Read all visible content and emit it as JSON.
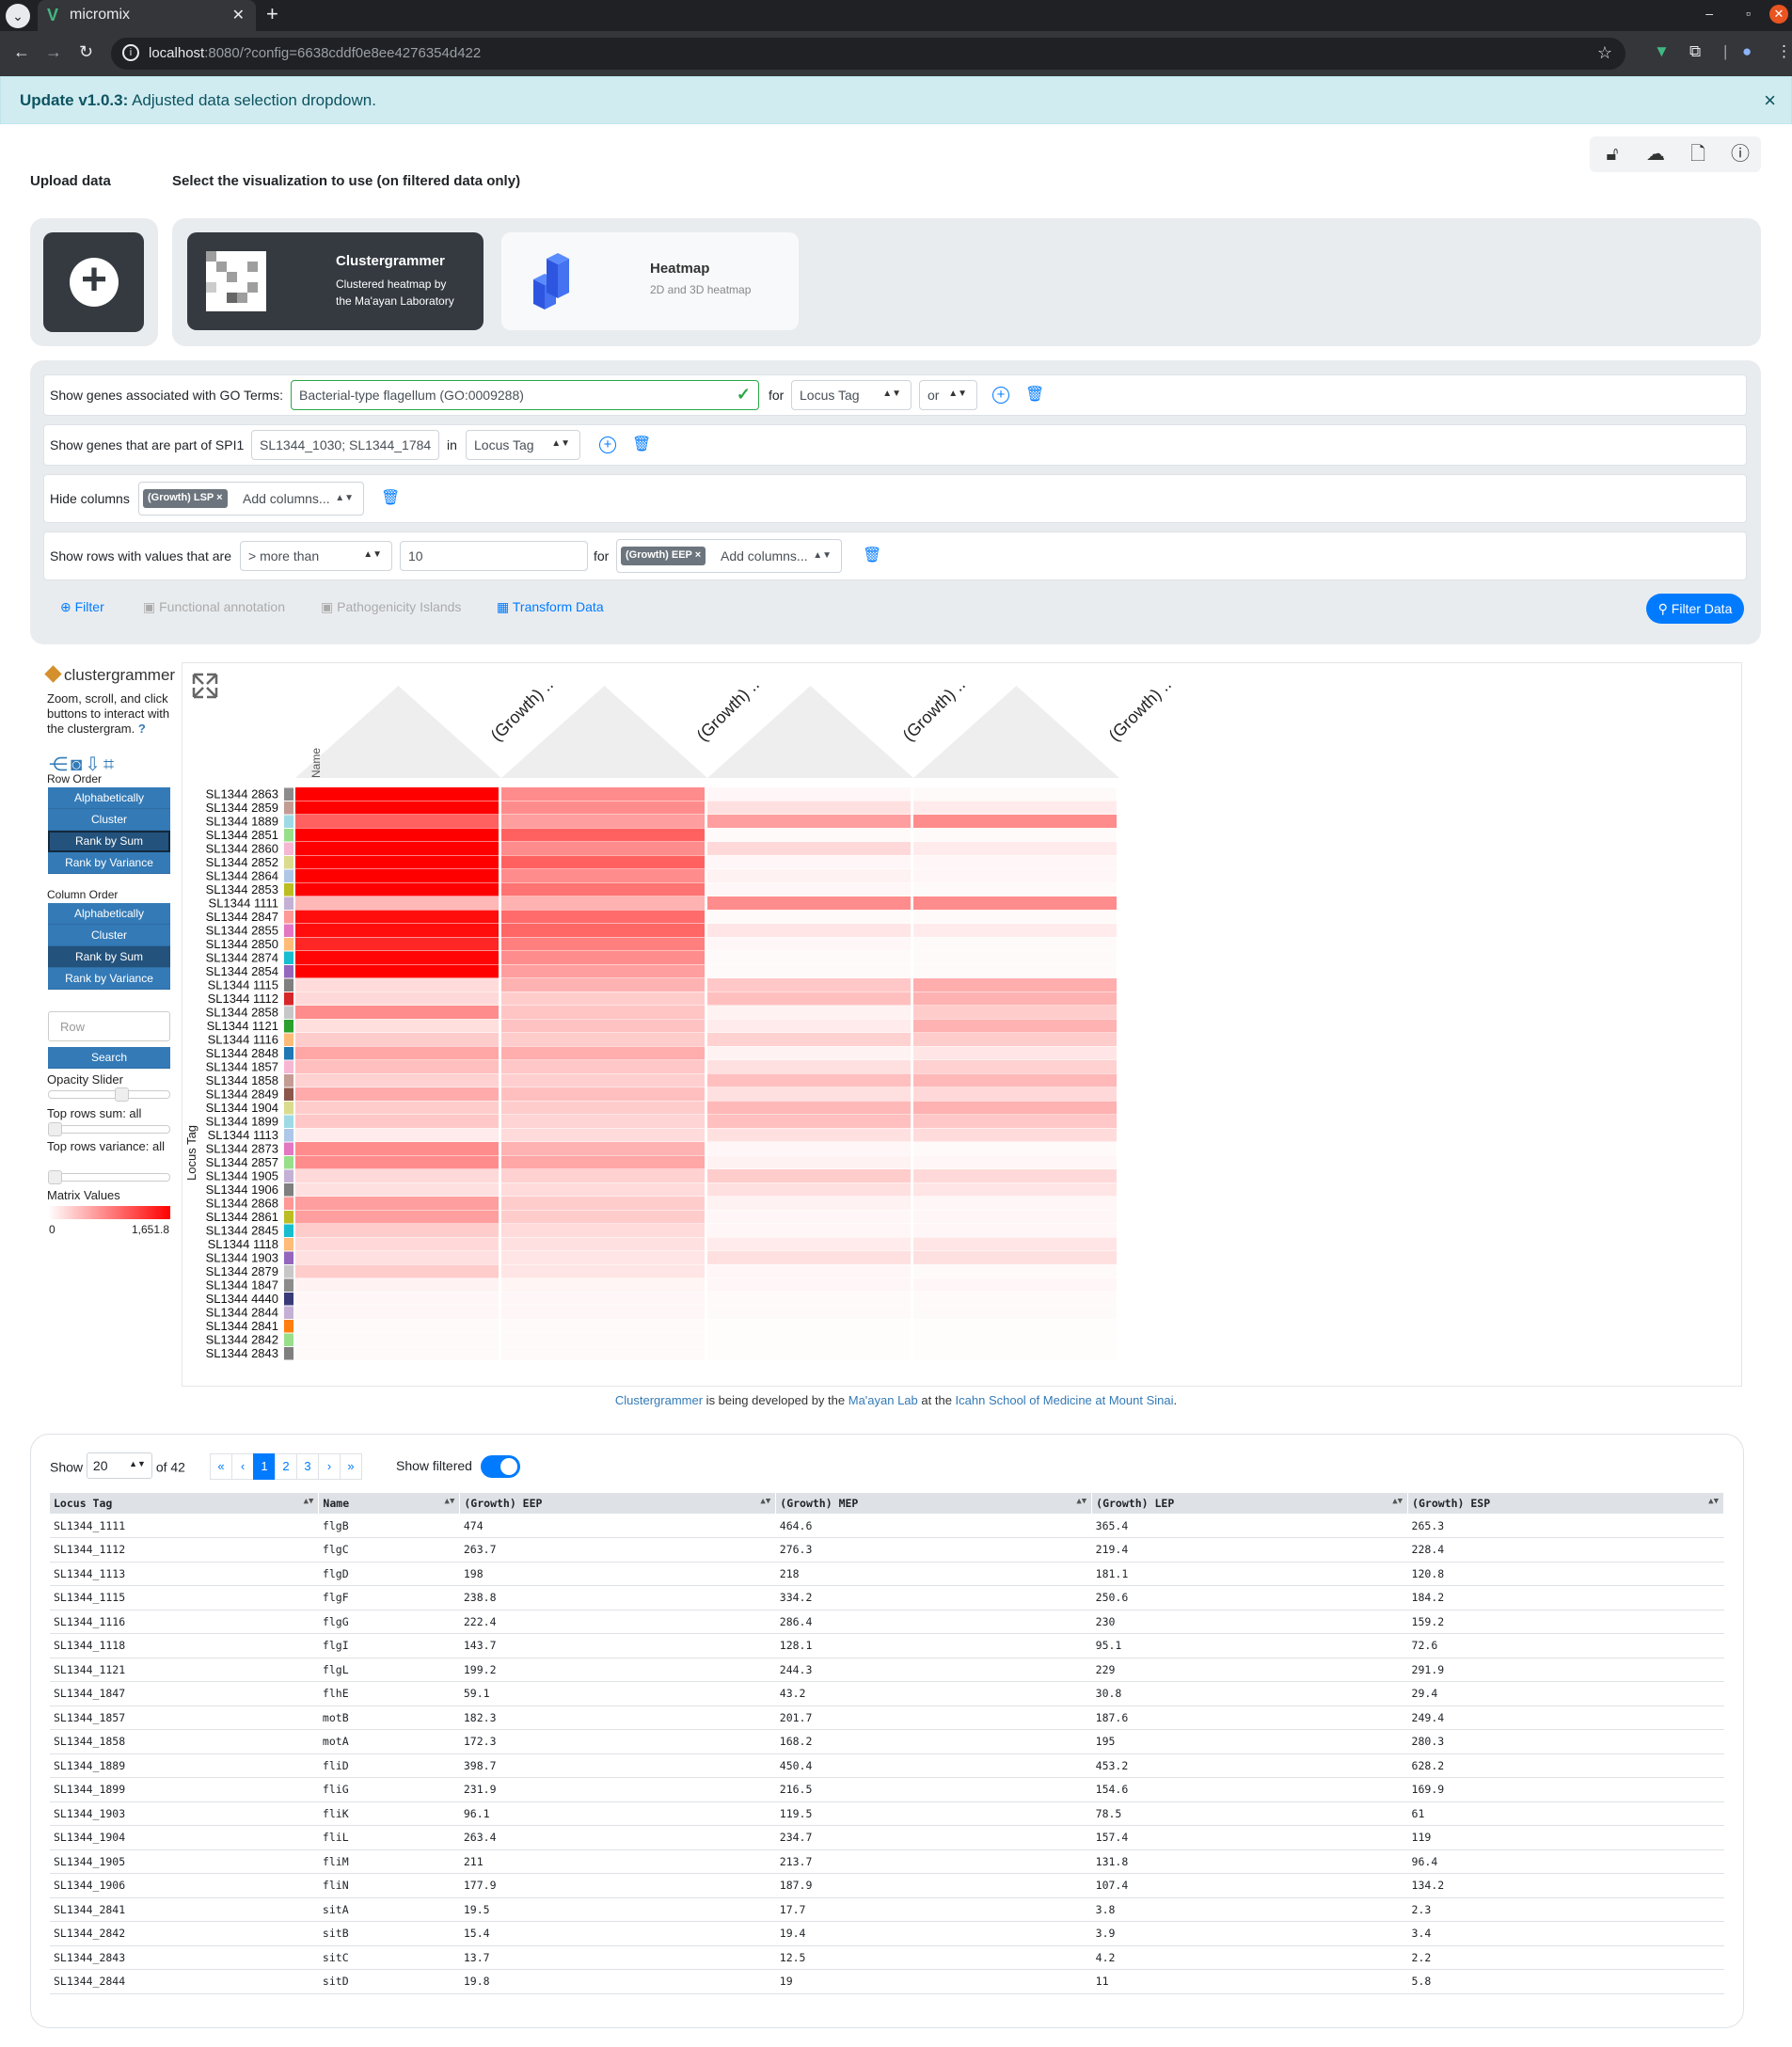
{
  "browser": {
    "tab_title": "micromix",
    "url_host": "localhost",
    "url_rest": ":8080/?config=6638cddf0e8ee4276354d422"
  },
  "alert": {
    "title": "Update v1.0.3:",
    "message": "Adjusted data selection dropdown."
  },
  "header": {
    "upload_label": "Upload data",
    "select_label": "Select the visualization to use (on filtered data only)"
  },
  "viz": {
    "clustergrammer": {
      "title": "Clustergrammer",
      "sub1": "Clustered heatmap by",
      "sub2": "the Ma'ayan Laboratory"
    },
    "heatmap": {
      "title": "Heatmap",
      "sub": "2D and 3D heatmap"
    }
  },
  "filters": {
    "go": {
      "label": "Show genes associated with GO Terms:",
      "value": "Bacterial-type flagellum (GO:0009288)",
      "for": "for",
      "field": "Locus Tag",
      "logic": "or"
    },
    "spi": {
      "label": "Show genes that are part of SPI1",
      "value": "SL1344_1030; SL1344_1784",
      "in": "in",
      "field": "Locus Tag"
    },
    "hide": {
      "label": "Hide columns",
      "tag": "(Growth) LSP",
      "placeholder": "Add columns..."
    },
    "rows": {
      "label": "Show rows with values that are",
      "op": "> more than",
      "value": "10",
      "for": "for",
      "tag": "(Growth) EEP",
      "placeholder": "Add columns..."
    },
    "tabs": {
      "filter": "Filter",
      "functional": "Functional annotation",
      "pathogenicity": "Pathogenicity Islands",
      "transform": "Transform Data"
    },
    "submit": "Filter Data"
  },
  "cg": {
    "logo": "clustergrammer",
    "desc": "Zoom, scroll, and click buttons to interact with the clustergram.",
    "help": "?",
    "row_order_label": "Row Order",
    "col_order_label": "Column Order",
    "order_buttons": [
      "Alphabetically",
      "Cluster",
      "Rank by Sum",
      "Rank by Variance"
    ],
    "row_placeholder": "Row",
    "search": "Search",
    "opacity": "Opacity Slider",
    "top_sum": "Top rows sum: all",
    "top_var": "Top rows variance: all",
    "matrix_values": "Matrix Values",
    "min": "0",
    "max": "1,651.8",
    "row_axis_label": "Locus Tag",
    "col_axis_label": "Name",
    "columns": [
      "(Growth) ..",
      "(Growth) ..",
      "(Growth) ..",
      "(Growth) .."
    ],
    "rows": [
      "SL1344 2863",
      "SL1344 2859",
      "SL1344 1889",
      "SL1344 2851",
      "SL1344 2860",
      "SL1344 2852",
      "SL1344 2864",
      "SL1344 2853",
      "SL1344 1111",
      "SL1344 2847",
      "SL1344 2855",
      "SL1344 2850",
      "SL1344 2874",
      "SL1344 2854",
      "SL1344 1115",
      "SL1344 1112",
      "SL1344 2858",
      "SL1344 1121",
      "SL1344 1116",
      "SL1344 2848",
      "SL1344 1857",
      "SL1344 1858",
      "SL1344 2849",
      "SL1344 1904",
      "SL1344 1899",
      "SL1344 1113",
      "SL1344 2873",
      "SL1344 2857",
      "SL1344 1905",
      "SL1344 1906",
      "SL1344 2868",
      "SL1344 2861",
      "SL1344 2845",
      "SL1344 1118",
      "SL1344 1903",
      "SL1344 2879",
      "SL1344 1847",
      "SL1344 4440",
      "SL1344 2844",
      "SL1344 2841",
      "SL1344 2842",
      "SL1344 2843"
    ],
    "row_colors": [
      "#8c8c8c",
      "#c49c94",
      "#9edae5",
      "#98df8a",
      "#f7b6d2",
      "#dbdb8d",
      "#aec7e8",
      "#bcbd22",
      "#c5b0d5",
      "#ff9896",
      "#e377c2",
      "#ffbb78",
      "#17becf",
      "#9467bd",
      "#7f7f7f",
      "#d62728",
      "#c7c7c7",
      "#2ca02c",
      "#ffbb78",
      "#1f77b4",
      "#f7b6d2",
      "#c49c94",
      "#8c564b",
      "#dbdb8d",
      "#9edae5",
      "#aec7e8",
      "#e377c2",
      "#98df8a",
      "#c5b0d5",
      "#7f7f7f",
      "#ff9896",
      "#bcbd22",
      "#17becf",
      "#ffbb78",
      "#9467bd",
      "#c7c7c7",
      "#8c8c8c",
      "#393b79",
      "#c5b0d5",
      "#ff7f0e",
      "#98df8a",
      "#7f7f7f"
    ],
    "matrix": [
      [
        1.0,
        0.45,
        0.03,
        0.02
      ],
      [
        1.0,
        0.45,
        0.12,
        0.08
      ],
      [
        0.62,
        0.38,
        0.38,
        0.45
      ],
      [
        1.0,
        0.62,
        0.02,
        0.02
      ],
      [
        1.0,
        0.45,
        0.15,
        0.08
      ],
      [
        1.0,
        0.62,
        0.03,
        0.03
      ],
      [
        1.0,
        0.45,
        0.05,
        0.03
      ],
      [
        1.0,
        0.55,
        0.03,
        0.02
      ],
      [
        0.28,
        0.3,
        0.45,
        0.45
      ],
      [
        0.95,
        0.58,
        0.02,
        0.02
      ],
      [
        0.95,
        0.6,
        0.1,
        0.08
      ],
      [
        0.85,
        0.5,
        0.03,
        0.02
      ],
      [
        0.98,
        0.45,
        0.02,
        0.02
      ],
      [
        1.0,
        0.38,
        0.02,
        0.02
      ],
      [
        0.14,
        0.3,
        0.22,
        0.32
      ],
      [
        0.15,
        0.2,
        0.25,
        0.3
      ],
      [
        0.45,
        0.23,
        0.05,
        0.2
      ],
      [
        0.13,
        0.24,
        0.08,
        0.3
      ],
      [
        0.2,
        0.2,
        0.18,
        0.2
      ],
      [
        0.35,
        0.32,
        0.05,
        0.1
      ],
      [
        0.25,
        0.22,
        0.12,
        0.18
      ],
      [
        0.18,
        0.19,
        0.25,
        0.28
      ],
      [
        0.33,
        0.25,
        0.12,
        0.15
      ],
      [
        0.2,
        0.2,
        0.28,
        0.3
      ],
      [
        0.22,
        0.17,
        0.25,
        0.22
      ],
      [
        0.08,
        0.14,
        0.12,
        0.14
      ],
      [
        0.45,
        0.3,
        0.03,
        0.02
      ],
      [
        0.45,
        0.35,
        0.05,
        0.03
      ],
      [
        0.15,
        0.18,
        0.2,
        0.15
      ],
      [
        0.12,
        0.14,
        0.12,
        0.1
      ],
      [
        0.38,
        0.2,
        0.05,
        0.03
      ],
      [
        0.38,
        0.2,
        0.03,
        0.03
      ],
      [
        0.2,
        0.14,
        0.03,
        0.03
      ],
      [
        0.15,
        0.12,
        0.08,
        0.1
      ],
      [
        0.12,
        0.1,
        0.12,
        0.12
      ],
      [
        0.2,
        0.1,
        0.03,
        0.02
      ],
      [
        0.05,
        0.04,
        0.03,
        0.03
      ],
      [
        0.03,
        0.03,
        0.02,
        0.02
      ],
      [
        0.03,
        0.03,
        0.02,
        0.02
      ],
      [
        0.02,
        0.02,
        0.01,
        0.01
      ],
      [
        0.02,
        0.02,
        0.01,
        0.01
      ],
      [
        0.02,
        0.02,
        0.01,
        0.01
      ]
    ]
  },
  "credit": {
    "cg": "Clustergrammer",
    "t1": " is being developed by the ",
    "lab": "Ma'ayan Lab",
    "t2": " at the ",
    "school": "Icahn School of Medicine at Mount Sinai",
    "t3": "."
  },
  "table": {
    "show": "Show",
    "per_page": "20",
    "of": "of 42",
    "pages": [
      "«",
      "‹",
      "1",
      "2",
      "3",
      "›",
      "»"
    ],
    "show_filtered": "Show filtered",
    "headers": [
      "Locus Tag",
      "Name",
      "(Growth) EEP",
      "(Growth) MEP",
      "(Growth) LEP",
      "(Growth) ESP"
    ],
    "rows": [
      [
        "SL1344_1111",
        "flgB",
        "474",
        "464.6",
        "365.4",
        "265.3"
      ],
      [
        "SL1344_1112",
        "flgC",
        "263.7",
        "276.3",
        "219.4",
        "228.4"
      ],
      [
        "SL1344_1113",
        "flgD",
        "198",
        "218",
        "181.1",
        "120.8"
      ],
      [
        "SL1344_1115",
        "flgF",
        "238.8",
        "334.2",
        "250.6",
        "184.2"
      ],
      [
        "SL1344_1116",
        "flgG",
        "222.4",
        "286.4",
        "230",
        "159.2"
      ],
      [
        "SL1344_1118",
        "flgI",
        "143.7",
        "128.1",
        "95.1",
        "72.6"
      ],
      [
        "SL1344_1121",
        "flgL",
        "199.2",
        "244.3",
        "229",
        "291.9"
      ],
      [
        "SL1344_1847",
        "flhE",
        "59.1",
        "43.2",
        "30.8",
        "29.4"
      ],
      [
        "SL1344_1857",
        "motB",
        "182.3",
        "201.7",
        "187.6",
        "249.4"
      ],
      [
        "SL1344_1858",
        "motA",
        "172.3",
        "168.2",
        "195",
        "280.3"
      ],
      [
        "SL1344_1889",
        "fliD",
        "398.7",
        "450.4",
        "453.2",
        "628.2"
      ],
      [
        "SL1344_1899",
        "fliG",
        "231.9",
        "216.5",
        "154.6",
        "169.9"
      ],
      [
        "SL1344_1903",
        "fliK",
        "96.1",
        "119.5",
        "78.5",
        "61"
      ],
      [
        "SL1344_1904",
        "fliL",
        "263.4",
        "234.7",
        "157.4",
        "119"
      ],
      [
        "SL1344_1905",
        "fliM",
        "211",
        "213.7",
        "131.8",
        "96.4"
      ],
      [
        "SL1344_1906",
        "fliN",
        "177.9",
        "187.9",
        "107.4",
        "134.2"
      ],
      [
        "SL1344_2841",
        "sitA",
        "19.5",
        "17.7",
        "3.8",
        "2.3"
      ],
      [
        "SL1344_2842",
        "sitB",
        "15.4",
        "19.4",
        "3.9",
        "3.4"
      ],
      [
        "SL1344_2843",
        "sitC",
        "13.7",
        "12.5",
        "4.2",
        "2.2"
      ],
      [
        "SL1344_2844",
        "sitD",
        "19.8",
        "19",
        "11",
        "5.8"
      ]
    ]
  }
}
